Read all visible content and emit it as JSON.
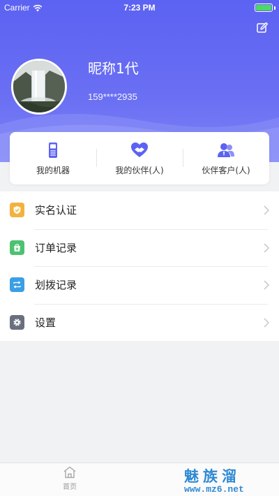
{
  "status_bar": {
    "carrier": "Carrier",
    "time": "7:23 PM"
  },
  "header": {
    "nickname": "昵称1代",
    "phone": "159****2935",
    "edit_icon": "edit-icon",
    "gradient_colors": [
      "#5c62f2",
      "#7d82f6"
    ]
  },
  "quick_links": [
    {
      "label": "我的机器",
      "icon": "phone-icon"
    },
    {
      "label": "我的伙伴(人)",
      "icon": "handshake-icon"
    },
    {
      "label": "伙伴客户(人)",
      "icon": "users-icon"
    }
  ],
  "menu": [
    {
      "label": "实名认证",
      "icon": "shield-check-icon",
      "color": "#f2b23d"
    },
    {
      "label": "订单记录",
      "icon": "bag-icon",
      "color": "#4cc271"
    },
    {
      "label": "划拨记录",
      "icon": "transfer-icon",
      "color": "#3a9fe5"
    },
    {
      "label": "设置",
      "icon": "gear-icon",
      "color": "#6a6f7e"
    }
  ],
  "tab_bar": {
    "home_label": "首页"
  },
  "watermark": {
    "line1": "魅族溜",
    "line2": "www.mz6.net"
  },
  "colors": {
    "accent": "#6167f3",
    "background": "#f1f2f4"
  }
}
